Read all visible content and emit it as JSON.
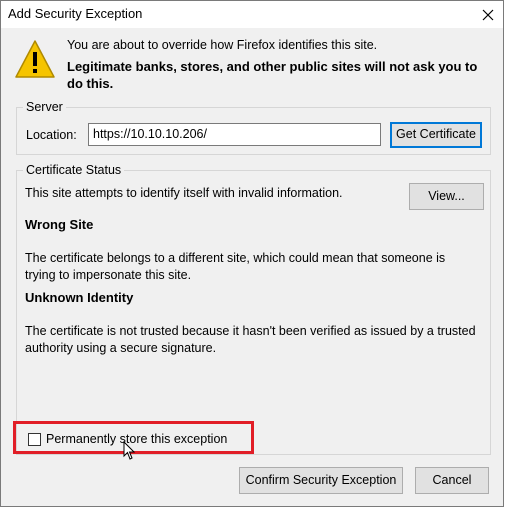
{
  "dialog": {
    "title": "Add Security Exception",
    "close_glyph": "✕",
    "intro": "You are about to override how Firefox identifies this site.",
    "warning": "Legitimate banks, stores, and other public sites will not ask you to do this."
  },
  "server": {
    "legend": "Server",
    "location_label": "Location:",
    "location_value": "https://10.10.10.206/",
    "get_cert_button": "Get Certificate"
  },
  "cert_status": {
    "legend": "Certificate Status",
    "intro": "This site attempts to identify itself with invalid information.",
    "view_button": "View...",
    "wrong_site_heading": "Wrong Site",
    "wrong_site_text_1": "The certificate belongs to a different site, which could mean that someone is",
    "wrong_site_text_2": "trying to impersonate this site.",
    "unknown_identity_heading": "Unknown Identity",
    "unknown_identity_text_1": "The certificate is not trusted because it hasn't been verified as issued by a trusted",
    "unknown_identity_text_2": "authority using a secure signature."
  },
  "store_checkbox": {
    "label": "Permanently store this exception",
    "checked": false
  },
  "buttons": {
    "confirm": "Confirm Security Exception",
    "cancel": "Cancel"
  },
  "colors": {
    "highlight": "#e11e27",
    "focus_border": "#0078d7",
    "warning_yellow": "#f5c400"
  }
}
